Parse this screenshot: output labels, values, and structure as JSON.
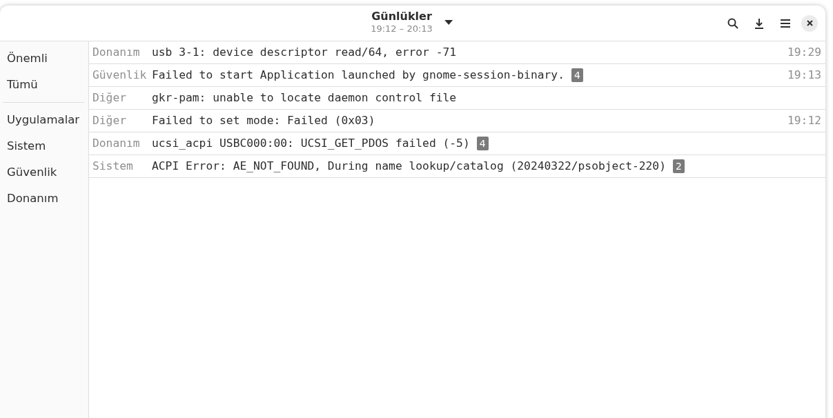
{
  "window": {
    "title": "Günlükler",
    "subtitle": "19:12 – 20:13"
  },
  "sidebar": {
    "groups": [
      [
        {
          "label": "Önemli",
          "selected": false
        },
        {
          "label": "Tümü",
          "selected": false
        }
      ],
      [
        {
          "label": "Uygulamalar",
          "selected": false
        },
        {
          "label": "Sistem",
          "selected": false
        },
        {
          "label": "Güvenlik",
          "selected": false
        },
        {
          "label": "Donanım",
          "selected": false
        }
      ]
    ]
  },
  "events": [
    {
      "category": "Donanım",
      "message": "usb 3-1: device descriptor read/64, error -71",
      "time": "19:29"
    },
    {
      "category": "Güvenlik",
      "message": "Failed to start Application launched by gnome-session-binary.",
      "count": "4",
      "time": "19:13"
    },
    {
      "category": "Diğer",
      "message": "gkr-pam: unable to locate daemon control file"
    },
    {
      "category": "Diğer",
      "message": "Failed to set mode: Failed (0x03)",
      "time": "19:12"
    },
    {
      "category": "Donanım",
      "message": "ucsi_acpi USBC000:00: UCSI_GET_PDOS failed (-5)",
      "count": "4"
    },
    {
      "category": "Sistem",
      "message": "ACPI Error: AE_NOT_FOUND, During name lookup/catalog (20240322/psobject-220)",
      "count": "2"
    }
  ]
}
